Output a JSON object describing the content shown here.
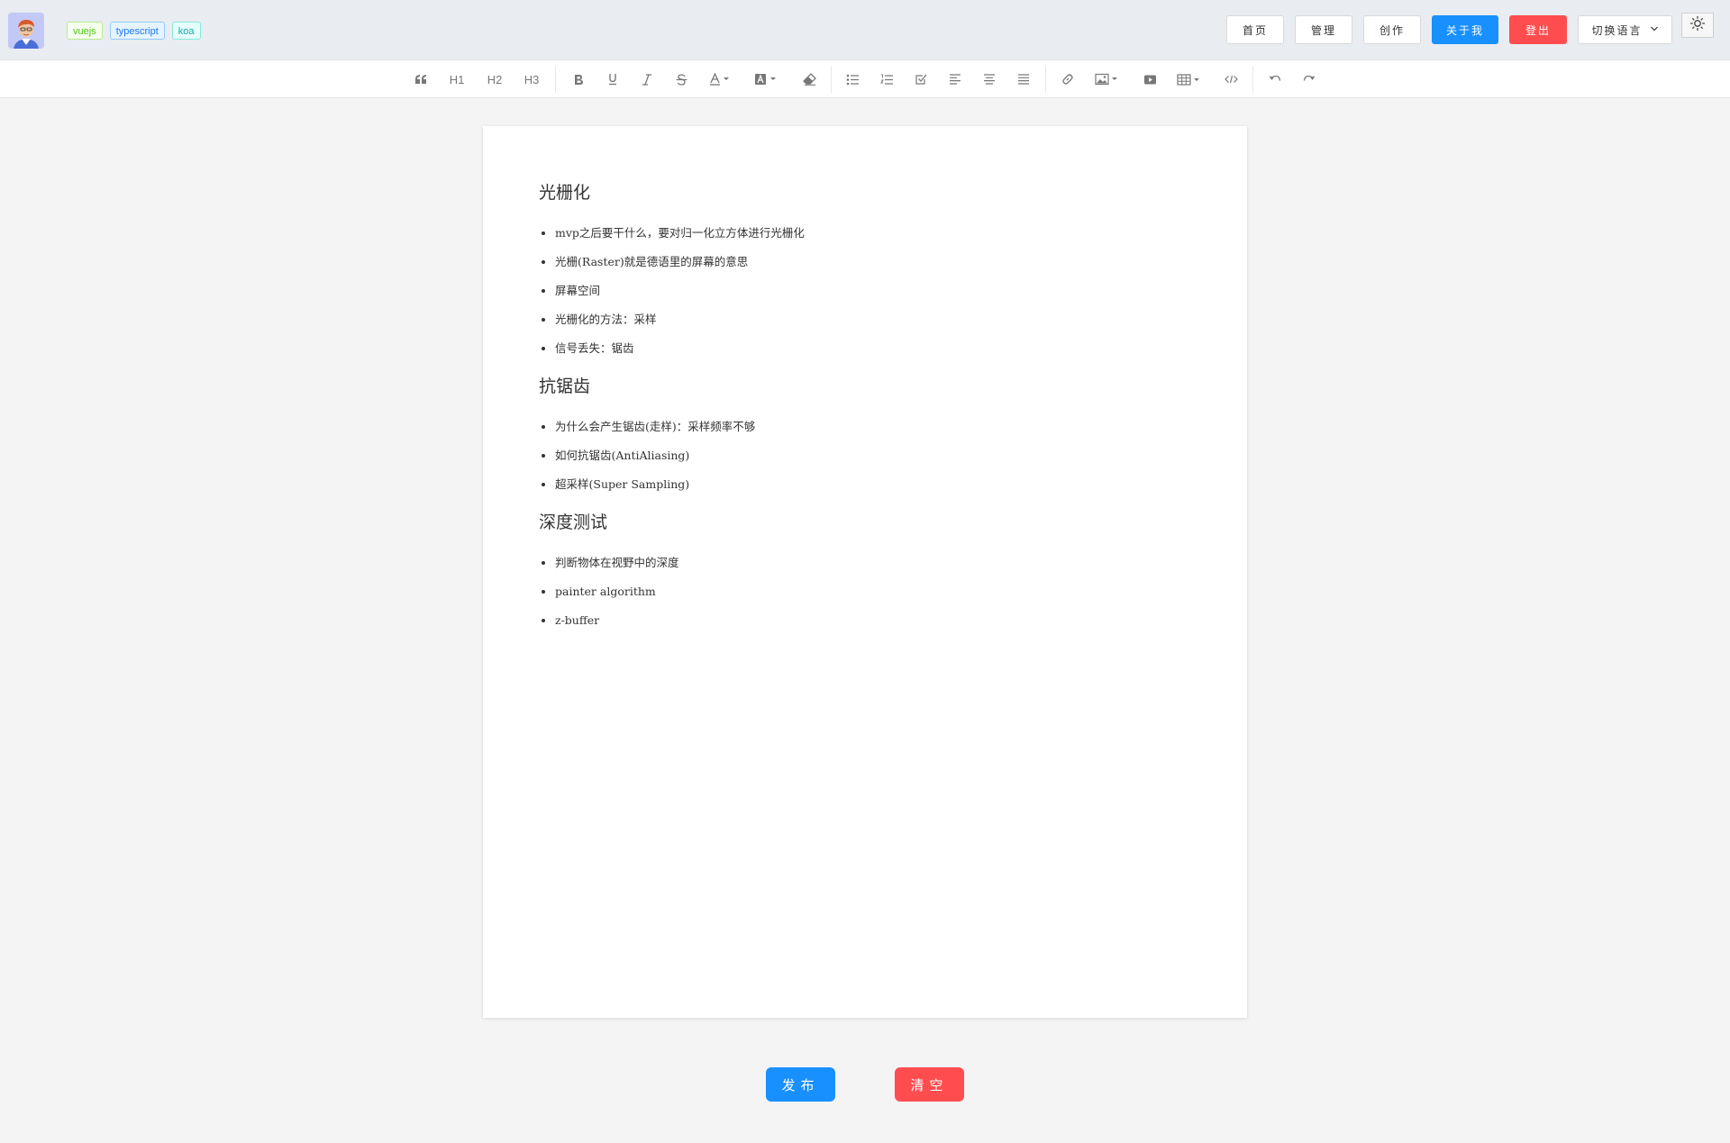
{
  "header": {
    "tags": [
      "vuejs",
      "typescript",
      "koa"
    ],
    "nav": {
      "home": "首页",
      "manage": "管理",
      "create": "创作",
      "about": "关于我",
      "logout": "登出",
      "language": "切换语言"
    }
  },
  "toolbar": {
    "h1": "H1",
    "h2": "H2",
    "h3": "H3"
  },
  "document": {
    "sections": [
      {
        "heading": "光栅化",
        "items": [
          "mvp之后要干什么，要对归一化立方体进行光栅化",
          "光栅(Raster)就是德语里的屏幕的意思",
          "屏幕空间",
          "光栅化的方法：采样",
          "信号丢失：锯齿"
        ]
      },
      {
        "heading": "抗锯齿",
        "items": [
          "为什么会产生锯齿(走样)：采样频率不够",
          "如何抗锯齿(AntiAliasing)",
          "超采样(Super Sampling)"
        ]
      },
      {
        "heading": "深度测试",
        "items": [
          "判断物体在视野中的深度",
          "painter algorithm",
          "z-buffer"
        ]
      }
    ]
  },
  "actions": {
    "publish": "发布",
    "clear": "清空"
  },
  "colors": {
    "primary": "#1890ff",
    "danger": "#ff4d4f"
  }
}
